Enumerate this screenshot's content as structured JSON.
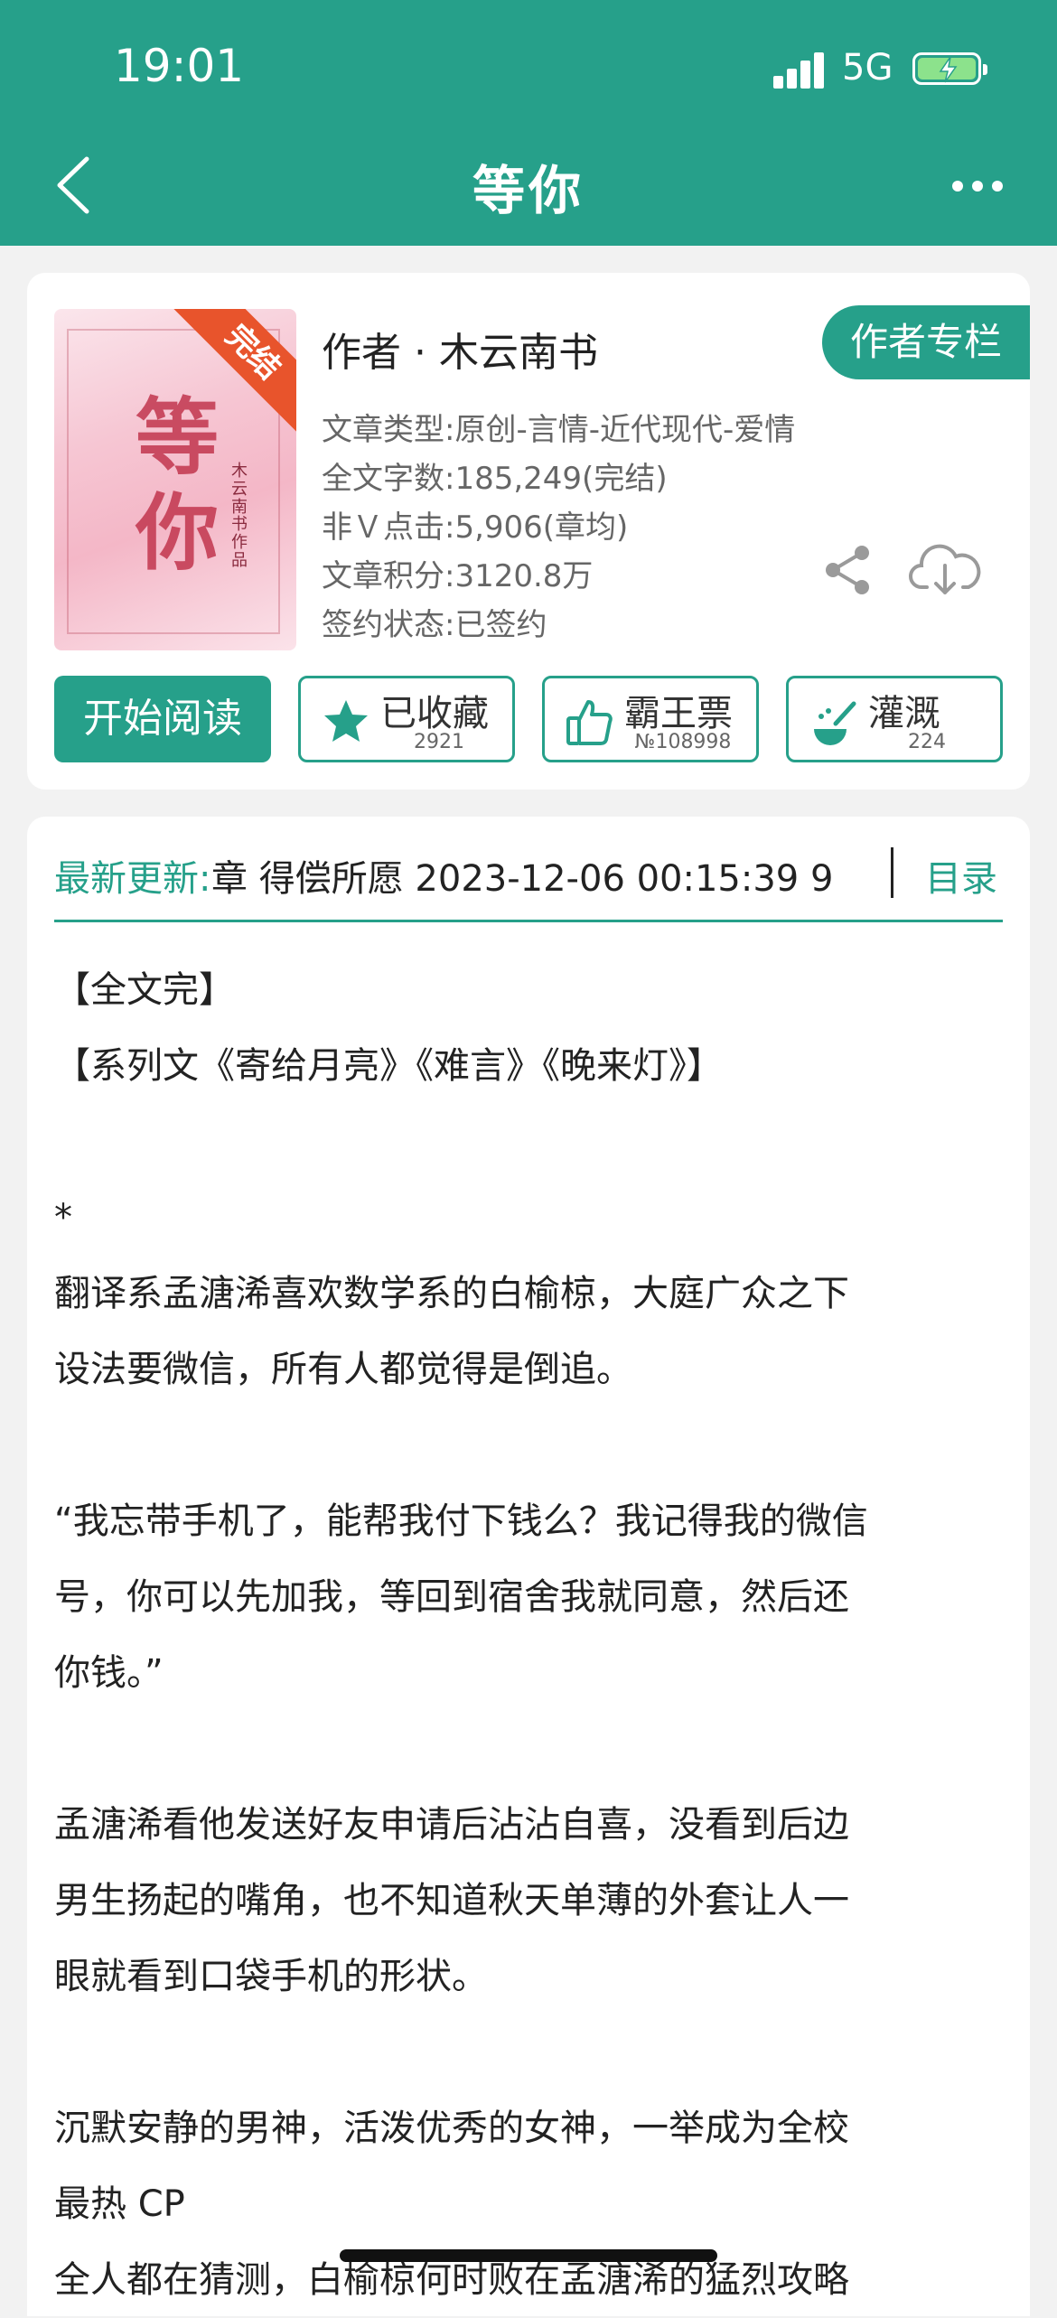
{
  "status": {
    "time": "19:01",
    "network": "5G"
  },
  "nav": {
    "title": "等你"
  },
  "book": {
    "cover": {
      "ribbon": "完结",
      "title_art": "等\n你",
      "by": "木云南书作品"
    },
    "author": "作者 · 木云南书",
    "author_column_button": "作者专栏",
    "info": [
      "文章类型:原创-言情-近代现代-爱情",
      "全文字数:185,249(完结)",
      "非Ｖ点击:5,906(章均)",
      "文章积分:3120.8万",
      "签约状态:已签约"
    ]
  },
  "actions": {
    "read": "开始阅读",
    "collect": {
      "label": "已收藏",
      "count": "2921"
    },
    "ticket": {
      "label": "霸王票",
      "count": "№108998"
    },
    "nutrient": {
      "label": "灌溉",
      "count": "224"
    }
  },
  "update": {
    "label": "最新更新:",
    "text": "9 章 得偿所愿 2023-12-06 00:15:39",
    "toc": "目录"
  },
  "content": [
    "【全文完】",
    "【系列文《寄给月亮》《难言》《晚来灯》】",
    "",
    "*",
    "翻译系孟溏浠喜欢数学系的白榆椋，大庭广众之下",
    "设法要微信，所有人都觉得是倒追。",
    "",
    "“我忘带手机了，能帮我付下钱么？我记得我的微信",
    "号，你可以先加我，等回到宿舍我就同意，然后还",
    "你钱。”",
    "",
    "孟溏浠看他发送好友申请后沾沾自喜，没看到后边",
    "男生扬起的嘴角，也不知道秋天单薄的外套让人一",
    "眼就看到口袋手机的形状。",
    "",
    "沉默安静的男神，活泼优秀的女神，一举成为全校",
    "最热 CP",
    "全人都在猜测，白榆椋何时败在孟溏浠的猛烈攻略"
  ]
}
